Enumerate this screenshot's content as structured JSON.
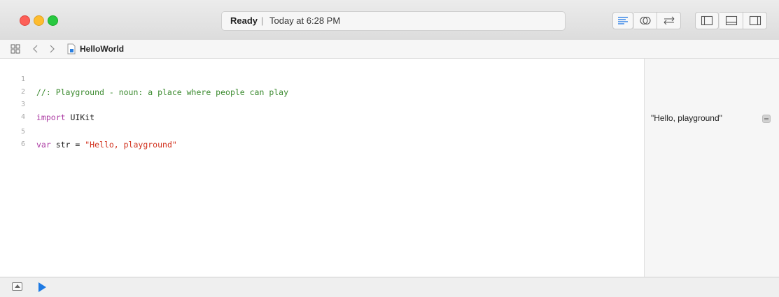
{
  "titlebar": {
    "status": "Ready",
    "separator": "|",
    "timestamp": "Today at 6:28 PM",
    "buttons": [
      "standard-editor-icon",
      "assistant-editor-icon",
      "version-editor-icon",
      "navigator-panel-icon",
      "debug-area-icon",
      "utilities-panel-icon"
    ]
  },
  "navbar": {
    "file_name": "HelloWorld",
    "icons": [
      "related-items-grid-icon",
      "back-chevron-icon",
      "forward-chevron-icon",
      "playground-file-icon"
    ]
  },
  "editor": {
    "lines": [
      {
        "number": "1",
        "text": "//: Playground - noun: a place where people can play"
      },
      {
        "number": "2",
        "text": ""
      },
      {
        "number": "3",
        "keyword": "import",
        "rest": " UIKit"
      },
      {
        "number": "4",
        "text": ""
      },
      {
        "number": "5",
        "keyword": "var",
        "rest": " str = ",
        "string": "\"Hello, playground\""
      },
      {
        "number": "6",
        "text": ""
      }
    ]
  },
  "results": {
    "value": "\"Hello, playground\""
  },
  "bottombar": {
    "icons": [
      "debug-area-toggle-icon",
      "run-play-icon"
    ]
  },
  "colors": {
    "comment": "#3b8a2f",
    "keyword": "#ad3da4",
    "string": "#d12f1b",
    "run": "#1e7ae3"
  }
}
